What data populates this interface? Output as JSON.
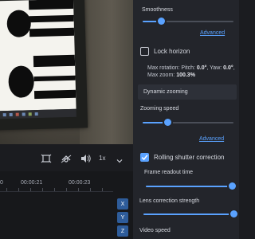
{
  "player": {
    "speed_value": "1x"
  },
  "timeline": {
    "tick_labels": [
      "0",
      "00:00:21",
      "00:00:23"
    ],
    "axis_buttons": [
      "X",
      "Y",
      "Z"
    ]
  },
  "panel": {
    "smoothness_label": "Smoothness",
    "smoothness_value": 0.2,
    "advanced_link_1": "Advanced",
    "lock_horizon_label": "Lock horizon",
    "lock_horizon_checked": false,
    "max_rotation_prefix": "Max rotation: Pitch: ",
    "max_rotation_pitch": "0.0°",
    "max_rotation_yaw_sep": ", Yaw: ",
    "max_rotation_yaw": "0.0°",
    "max_rotation_roll_sep": ",",
    "max_zoom_prefix": "Max zoom: ",
    "max_zoom_value": "100.3%",
    "dynamic_zooming_header": "Dynamic zooming",
    "zooming_speed_label": "Zooming speed",
    "zooming_speed_value": 0.27,
    "advanced_link_2": "Advanced",
    "rolling_shutter_label": "Rolling shutter correction",
    "rolling_shutter_checked": true,
    "frame_readout_label": "Frame readout time",
    "frame_readout_value": 0.96,
    "lens_correction_label": "Lens correction strength",
    "lens_correction_value": 1.0,
    "video_speed_label": "Video speed"
  },
  "colors": {
    "accent": "#5aa2ff",
    "panel_bg": "#23252b",
    "axis_button_bg": "#2e5c9a"
  },
  "icons": [
    "fit-frame-icon",
    "stabilize-icon",
    "volume-icon",
    "chevron-down-icon",
    "checkmark-icon"
  ]
}
